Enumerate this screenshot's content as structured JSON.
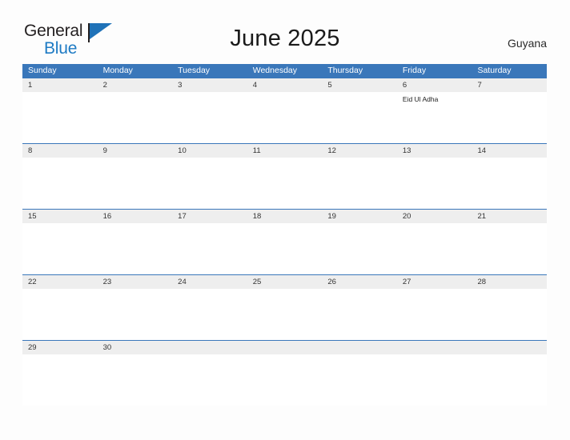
{
  "brand": {
    "name_line1": "General",
    "name_line2": "Blue",
    "flag_icon": "blue-triangle-flag",
    "accent_color": "#1f72b8"
  },
  "header": {
    "title": "June 2025",
    "country": "Guyana"
  },
  "theme": {
    "header_blue": "#3a77ba",
    "date_band_gray": "#eeeeee",
    "page_background": "#fdfdfd",
    "text_color": "#1a1a1a"
  },
  "calendar": {
    "month": "June",
    "year": "2025",
    "weekday_headers": [
      "Sunday",
      "Monday",
      "Tuesday",
      "Wednesday",
      "Thursday",
      "Friday",
      "Saturday"
    ],
    "weeks": [
      {
        "days": [
          {
            "date": "1",
            "events": []
          },
          {
            "date": "2",
            "events": []
          },
          {
            "date": "3",
            "events": []
          },
          {
            "date": "4",
            "events": []
          },
          {
            "date": "5",
            "events": []
          },
          {
            "date": "6",
            "events": [
              "Eid Ul Adha"
            ]
          },
          {
            "date": "7",
            "events": []
          }
        ]
      },
      {
        "days": [
          {
            "date": "8",
            "events": []
          },
          {
            "date": "9",
            "events": []
          },
          {
            "date": "10",
            "events": []
          },
          {
            "date": "11",
            "events": []
          },
          {
            "date": "12",
            "events": []
          },
          {
            "date": "13",
            "events": []
          },
          {
            "date": "14",
            "events": []
          }
        ]
      },
      {
        "days": [
          {
            "date": "15",
            "events": []
          },
          {
            "date": "16",
            "events": []
          },
          {
            "date": "17",
            "events": []
          },
          {
            "date": "18",
            "events": []
          },
          {
            "date": "19",
            "events": []
          },
          {
            "date": "20",
            "events": []
          },
          {
            "date": "21",
            "events": []
          }
        ]
      },
      {
        "days": [
          {
            "date": "22",
            "events": []
          },
          {
            "date": "23",
            "events": []
          },
          {
            "date": "24",
            "events": []
          },
          {
            "date": "25",
            "events": []
          },
          {
            "date": "26",
            "events": []
          },
          {
            "date": "27",
            "events": []
          },
          {
            "date": "28",
            "events": []
          }
        ]
      },
      {
        "days": [
          {
            "date": "29",
            "events": []
          },
          {
            "date": "30",
            "events": []
          },
          {
            "date": "",
            "events": []
          },
          {
            "date": "",
            "events": []
          },
          {
            "date": "",
            "events": []
          },
          {
            "date": "",
            "events": []
          },
          {
            "date": "",
            "events": []
          }
        ]
      }
    ]
  }
}
